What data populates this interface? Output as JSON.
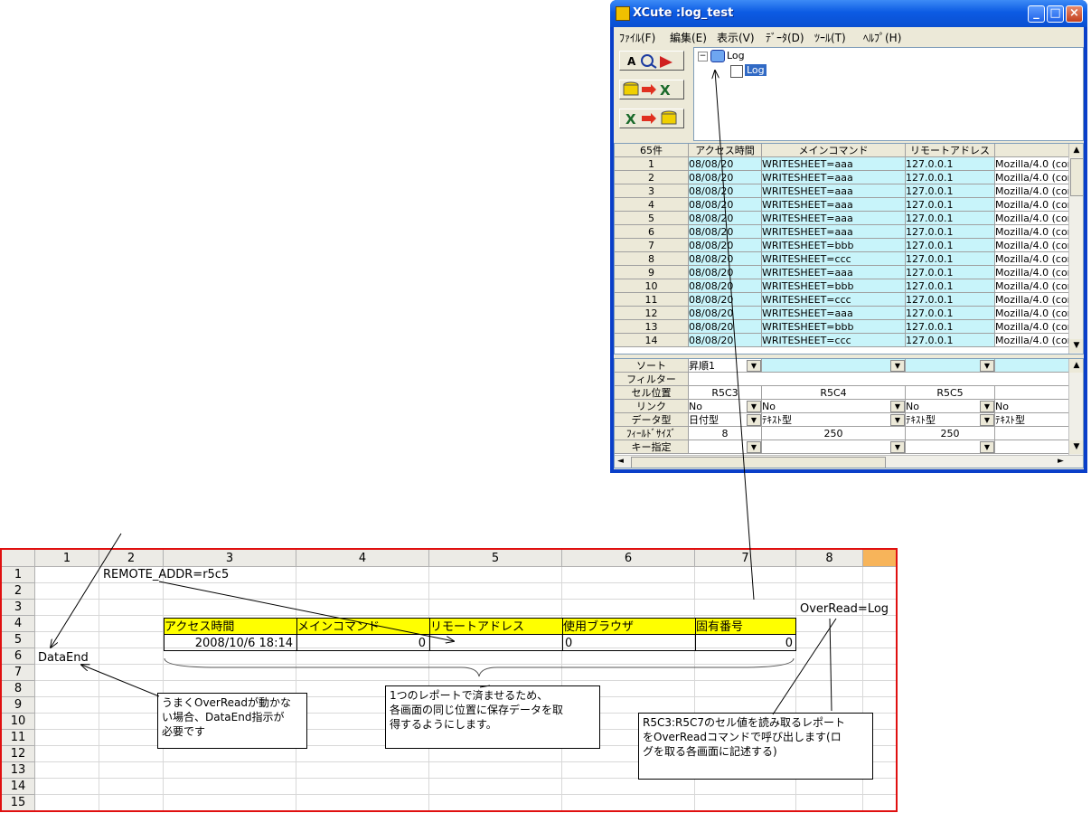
{
  "window": {
    "title": "XCute :log_test",
    "menu": [
      "ﾌｧｲﾙ(F)",
      "編集(E)",
      "表示(V)",
      "ﾃﾞｰﾀ(D)",
      "ﾂｰﾙ(T)",
      "ﾍﾙﾌﾟ(H)"
    ],
    "tree": {
      "root": "Log",
      "child": "Log",
      "expander": "−"
    }
  },
  "grid": {
    "count_label": "65件",
    "columns": [
      "アクセス時間",
      "メインコマンド",
      "リモートアドレス",
      ""
    ],
    "rows": [
      {
        "n": "1",
        "time": "08/08/20",
        "cmd": "WRITESHEET=aaa",
        "addr": "127.0.0.1",
        "ua": "Mozilla/4.0 (com"
      },
      {
        "n": "2",
        "time": "08/08/20",
        "cmd": "WRITESHEET=aaa",
        "addr": "127.0.0.1",
        "ua": "Mozilla/4.0 (com"
      },
      {
        "n": "3",
        "time": "08/08/20",
        "cmd": "WRITESHEET=aaa",
        "addr": "127.0.0.1",
        "ua": "Mozilla/4.0 (com"
      },
      {
        "n": "4",
        "time": "08/08/20",
        "cmd": "WRITESHEET=aaa",
        "addr": "127.0.0.1",
        "ua": "Mozilla/4.0 (com"
      },
      {
        "n": "5",
        "time": "08/08/20",
        "cmd": "WRITESHEET=aaa",
        "addr": "127.0.0.1",
        "ua": "Mozilla/4.0 (com"
      },
      {
        "n": "6",
        "time": "08/08/20",
        "cmd": "WRITESHEET=aaa",
        "addr": "127.0.0.1",
        "ua": "Mozilla/4.0 (com"
      },
      {
        "n": "7",
        "time": "08/08/20",
        "cmd": "WRITESHEET=bbb",
        "addr": "127.0.0.1",
        "ua": "Mozilla/4.0 (com"
      },
      {
        "n": "8",
        "time": "08/08/20",
        "cmd": "WRITESHEET=ccc",
        "addr": "127.0.0.1",
        "ua": "Mozilla/4.0 (com"
      },
      {
        "n": "9",
        "time": "08/08/20",
        "cmd": "WRITESHEET=aaa",
        "addr": "127.0.0.1",
        "ua": "Mozilla/4.0 (com"
      },
      {
        "n": "10",
        "time": "08/08/20",
        "cmd": "WRITESHEET=bbb",
        "addr": "127.0.0.1",
        "ua": "Mozilla/4.0 (com"
      },
      {
        "n": "11",
        "time": "08/08/20",
        "cmd": "WRITESHEET=ccc",
        "addr": "127.0.0.1",
        "ua": "Mozilla/4.0 (com"
      },
      {
        "n": "12",
        "time": "08/08/20",
        "cmd": "WRITESHEET=aaa",
        "addr": "127.0.0.1",
        "ua": "Mozilla/4.0 (com"
      },
      {
        "n": "13",
        "time": "08/08/20",
        "cmd": "WRITESHEET=bbb",
        "addr": "127.0.0.1",
        "ua": "Mozilla/4.0 (com"
      },
      {
        "n": "14",
        "time": "08/08/20",
        "cmd": "WRITESHEET=ccc",
        "addr": "127.0.0.1",
        "ua": "Mozilla/4.0 (com"
      }
    ]
  },
  "props": {
    "labels": [
      "ソート",
      "フィルター",
      "セル位置",
      "リンク",
      "データ型",
      "ﾌｨｰﾙﾄﾞｻｲｽﾞ",
      "キー指定"
    ],
    "sort": "昇順1",
    "cells": [
      "R5C3",
      "R5C4",
      "R5C5"
    ],
    "links": [
      "No",
      "No",
      "No",
      "No"
    ],
    "types": [
      "日付型",
      "ﾃｷｽﾄ型",
      "ﾃｷｽﾄ型",
      "ﾃｷｽﾄ型"
    ],
    "sizes": [
      "8",
      "250",
      "250"
    ]
  },
  "sheet": {
    "col_headers": [
      "1",
      "2",
      "3",
      "4",
      "5",
      "6",
      "7",
      "8"
    ],
    "row_headers": [
      "1",
      "2",
      "3",
      "4",
      "5",
      "6",
      "7",
      "8",
      "9",
      "10",
      "11",
      "12",
      "13",
      "14",
      "15"
    ],
    "remote_addr": "REMOTE_ADDR=r5c5",
    "overread": "OverRead=Log",
    "dataend": "DataEnd",
    "table_headers": [
      "アクセス時間",
      "メインコマンド",
      "リモートアドレス",
      "使用ブラウザ",
      "固有番号"
    ],
    "table_values": [
      "2008/10/6 18:14",
      "0",
      "",
      "0",
      "0"
    ]
  },
  "notes": {
    "overread_note": [
      "うまくOverReadが動かな",
      "い場合、DataEnd指示が",
      "必要です"
    ],
    "report_note": [
      "1つのレポートで済ませるため、",
      "各画面の同じ位置に保存データを取",
      "得するようにします。"
    ],
    "r5c3_note": [
      "R5C3:R5C7のセル値を読み取るレポート",
      "をOverReadコマンドで呼び出します(ロ",
      "グを取る各画面に記述する)"
    ]
  },
  "colors": {
    "accent_red": "#e01010",
    "highlight_yellow": "#ffff00",
    "grid_cyan": "#c8f4fa",
    "titlebar_blue": "#0a4fd1"
  }
}
